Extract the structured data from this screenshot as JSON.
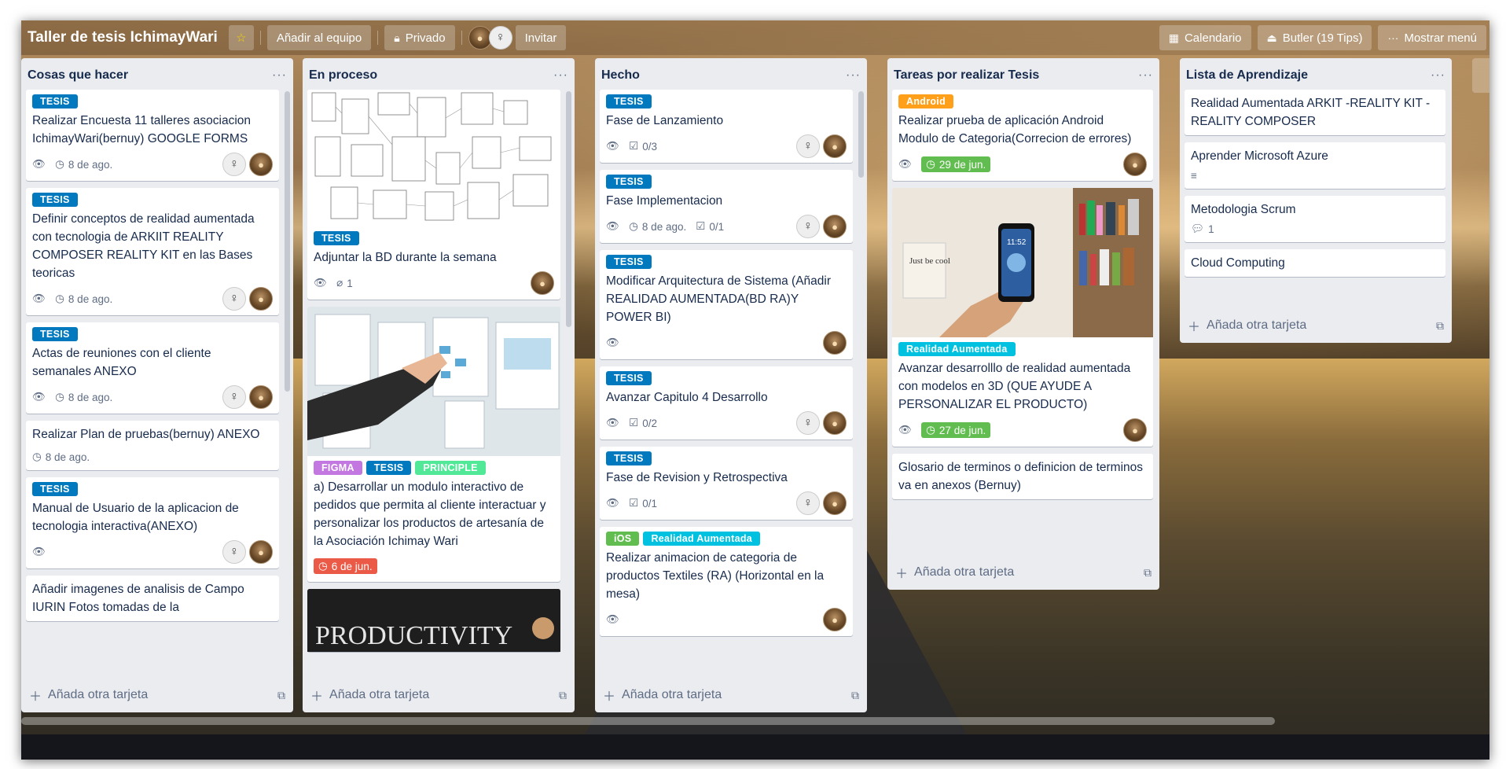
{
  "header": {
    "board_title": "Taller de tesis IchimayWari",
    "add_team": "Añadir al equipo",
    "privacy": "Privado",
    "invite": "Invitar",
    "calendar": "Calendario",
    "butler": "Butler (19 Tips)",
    "show_menu": "Mostrar menú",
    "star_icon": "star-icon",
    "lock_icon": "lock-icon",
    "calendar_icon": "calendar-icon",
    "butler_icon": "butler-icon",
    "menu_icon": "more-horizontal-icon"
  },
  "colors": {
    "tesis": "#0079bf",
    "android": "#ff9f1a",
    "ios": "#61bd4f",
    "realidad": "#00c2e0",
    "figma": "#c377e0",
    "principle": "#51e898",
    "due_green": "#61bd4f",
    "due_red": "#eb5a46"
  },
  "add_card_label": "Añada otra tarjeta",
  "lists": [
    {
      "title": "Cosas que hacer",
      "cards": [
        {
          "labels": [
            "TESIS"
          ],
          "title": "Realizar Encuesta 11 talleres asociacion IchimayWari(bernuy) GOOGLE FORMS",
          "due": "8 de ago."
        },
        {
          "labels": [
            "TESIS"
          ],
          "title": "Definir conceptos de realidad aumentada con tecnologia de ARKIIT REALITY COMPOSER REALITY KIT en las Bases teoricas",
          "due": "8 de ago."
        },
        {
          "labels": [
            "TESIS"
          ],
          "title": "Actas de reuniones con el cliente semanales ANEXO",
          "due": "8 de ago."
        },
        {
          "title": "Realizar Plan de pruebas(bernuy) ANEXO",
          "due": "8 de ago."
        },
        {
          "labels": [
            "TESIS"
          ],
          "title": "Manual de Usuario de la aplicacion de tecnologia interactiva(ANEXO)"
        },
        {
          "title": "Añadir imagenes de analisis de Campo IURIN Fotos tomadas de la"
        }
      ]
    },
    {
      "title": "En proceso",
      "cards": [
        {
          "labels": [
            "TESIS"
          ],
          "title": "Adjuntar la BD durante la semana",
          "attachments": "1"
        },
        {
          "labels": [
            "FIGMA",
            "TESIS",
            "PRINCIPLE"
          ],
          "title": "a) Desarrollar un modulo interactivo de pedidos que permita al cliente interactuar y personalizar los productos de artesanía de la Asociación Ichimay Wari",
          "due": "6 de jun."
        },
        {
          "cover_text": "PRODUCTIVITY"
        }
      ]
    },
    {
      "title": "Hecho",
      "cards": [
        {
          "labels": [
            "TESIS"
          ],
          "title": "Fase de Lanzamiento",
          "checklist": "0/3"
        },
        {
          "labels": [
            "TESIS"
          ],
          "title": "Fase Implementacion",
          "due": "8 de ago.",
          "checklist": "0/1"
        },
        {
          "labels": [
            "TESIS"
          ],
          "title": "Modificar Arquitectura de Sistema (Añadir REALIDAD AUMENTADA(BD RA)Y POWER BI)"
        },
        {
          "labels": [
            "TESIS"
          ],
          "title": "Avanzar Capitulo 4 Desarrollo",
          "checklist": "0/2"
        },
        {
          "labels": [
            "TESIS"
          ],
          "title": "Fase de Revision y Retrospectiva",
          "checklist": "0/1"
        },
        {
          "labels": [
            "iOS",
            "Realidad Aumentada"
          ],
          "title": "Realizar animacion de categoria de productos Textiles (RA) (Horizontal en la mesa)"
        }
      ]
    },
    {
      "title": "Tareas por realizar Tesis",
      "cards": [
        {
          "labels": [
            "Android"
          ],
          "title": "Realizar prueba de aplicación Android Modulo de Categoria(Correcion de errores)",
          "due": "29 de jun."
        },
        {
          "labels": [
            "Realidad Aumentada"
          ],
          "title": "Avanzar desarrolllo de realidad aumentada con modelos en 3D (QUE AYUDE A PERSONALIZAR EL PRODUCTO)",
          "due": "27 de jun."
        },
        {
          "title": "Glosario de terminos o definicion de terminos va en anexos (Bernuy)"
        }
      ]
    },
    {
      "title": "Lista de Aprendizaje",
      "cards": [
        {
          "title": "Realidad Aumentada ARKIT -REALITY KIT -REALITY COMPOSER"
        },
        {
          "title": "Aprender Microsoft Azure"
        },
        {
          "title": "Metodologia Scrum",
          "comments": "1"
        },
        {
          "title": "Cloud Computing"
        }
      ]
    }
  ],
  "cover_texts": {
    "phone_time": "11:52",
    "note": "Just be cool"
  }
}
